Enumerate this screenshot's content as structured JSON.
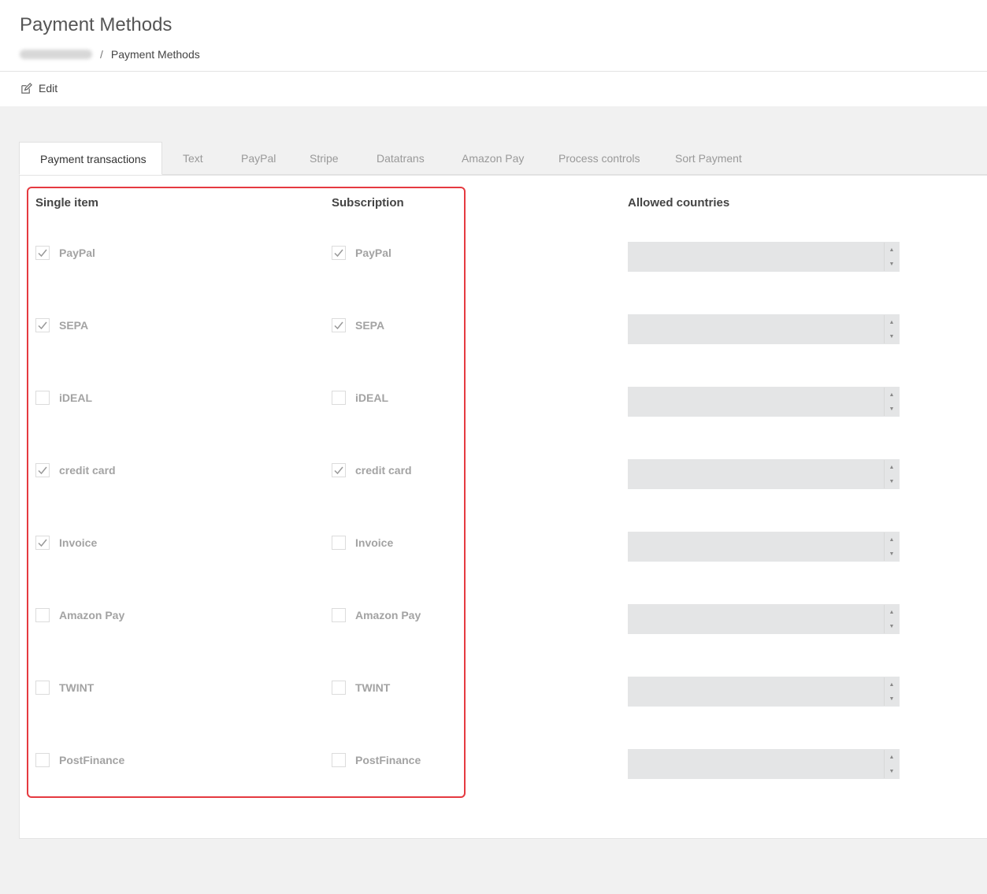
{
  "page": {
    "title": "Payment Methods",
    "breadcrumb": {
      "separator": "/",
      "current": "Payment Methods"
    }
  },
  "toolbar": {
    "edit_label": "Edit"
  },
  "tabs": [
    {
      "label": "Payment transactions",
      "active": true
    },
    {
      "label": "Text"
    },
    {
      "label": "PayPal"
    },
    {
      "label": "Stripe"
    },
    {
      "label": "Datatrans"
    },
    {
      "label": "Amazon Pay"
    },
    {
      "label": "Process controls"
    },
    {
      "label": "Sort Payment"
    }
  ],
  "columns": {
    "single": "Single item",
    "subscription": "Subscription",
    "countries": "Allowed countries"
  },
  "methods": [
    {
      "label": "PayPal",
      "single": true,
      "subscription": true
    },
    {
      "label": "SEPA",
      "single": true,
      "subscription": true
    },
    {
      "label": "iDEAL",
      "single": false,
      "subscription": false
    },
    {
      "label": "credit card",
      "single": true,
      "subscription": true
    },
    {
      "label": "Invoice",
      "single": true,
      "subscription": false
    },
    {
      "label": "Amazon Pay",
      "single": false,
      "subscription": false
    },
    {
      "label": "TWINT",
      "single": false,
      "subscription": false
    },
    {
      "label": "PostFinance",
      "single": false,
      "subscription": false
    }
  ],
  "colors": {
    "highlight": "#e53a40",
    "field_bg": "#e4e5e6"
  }
}
